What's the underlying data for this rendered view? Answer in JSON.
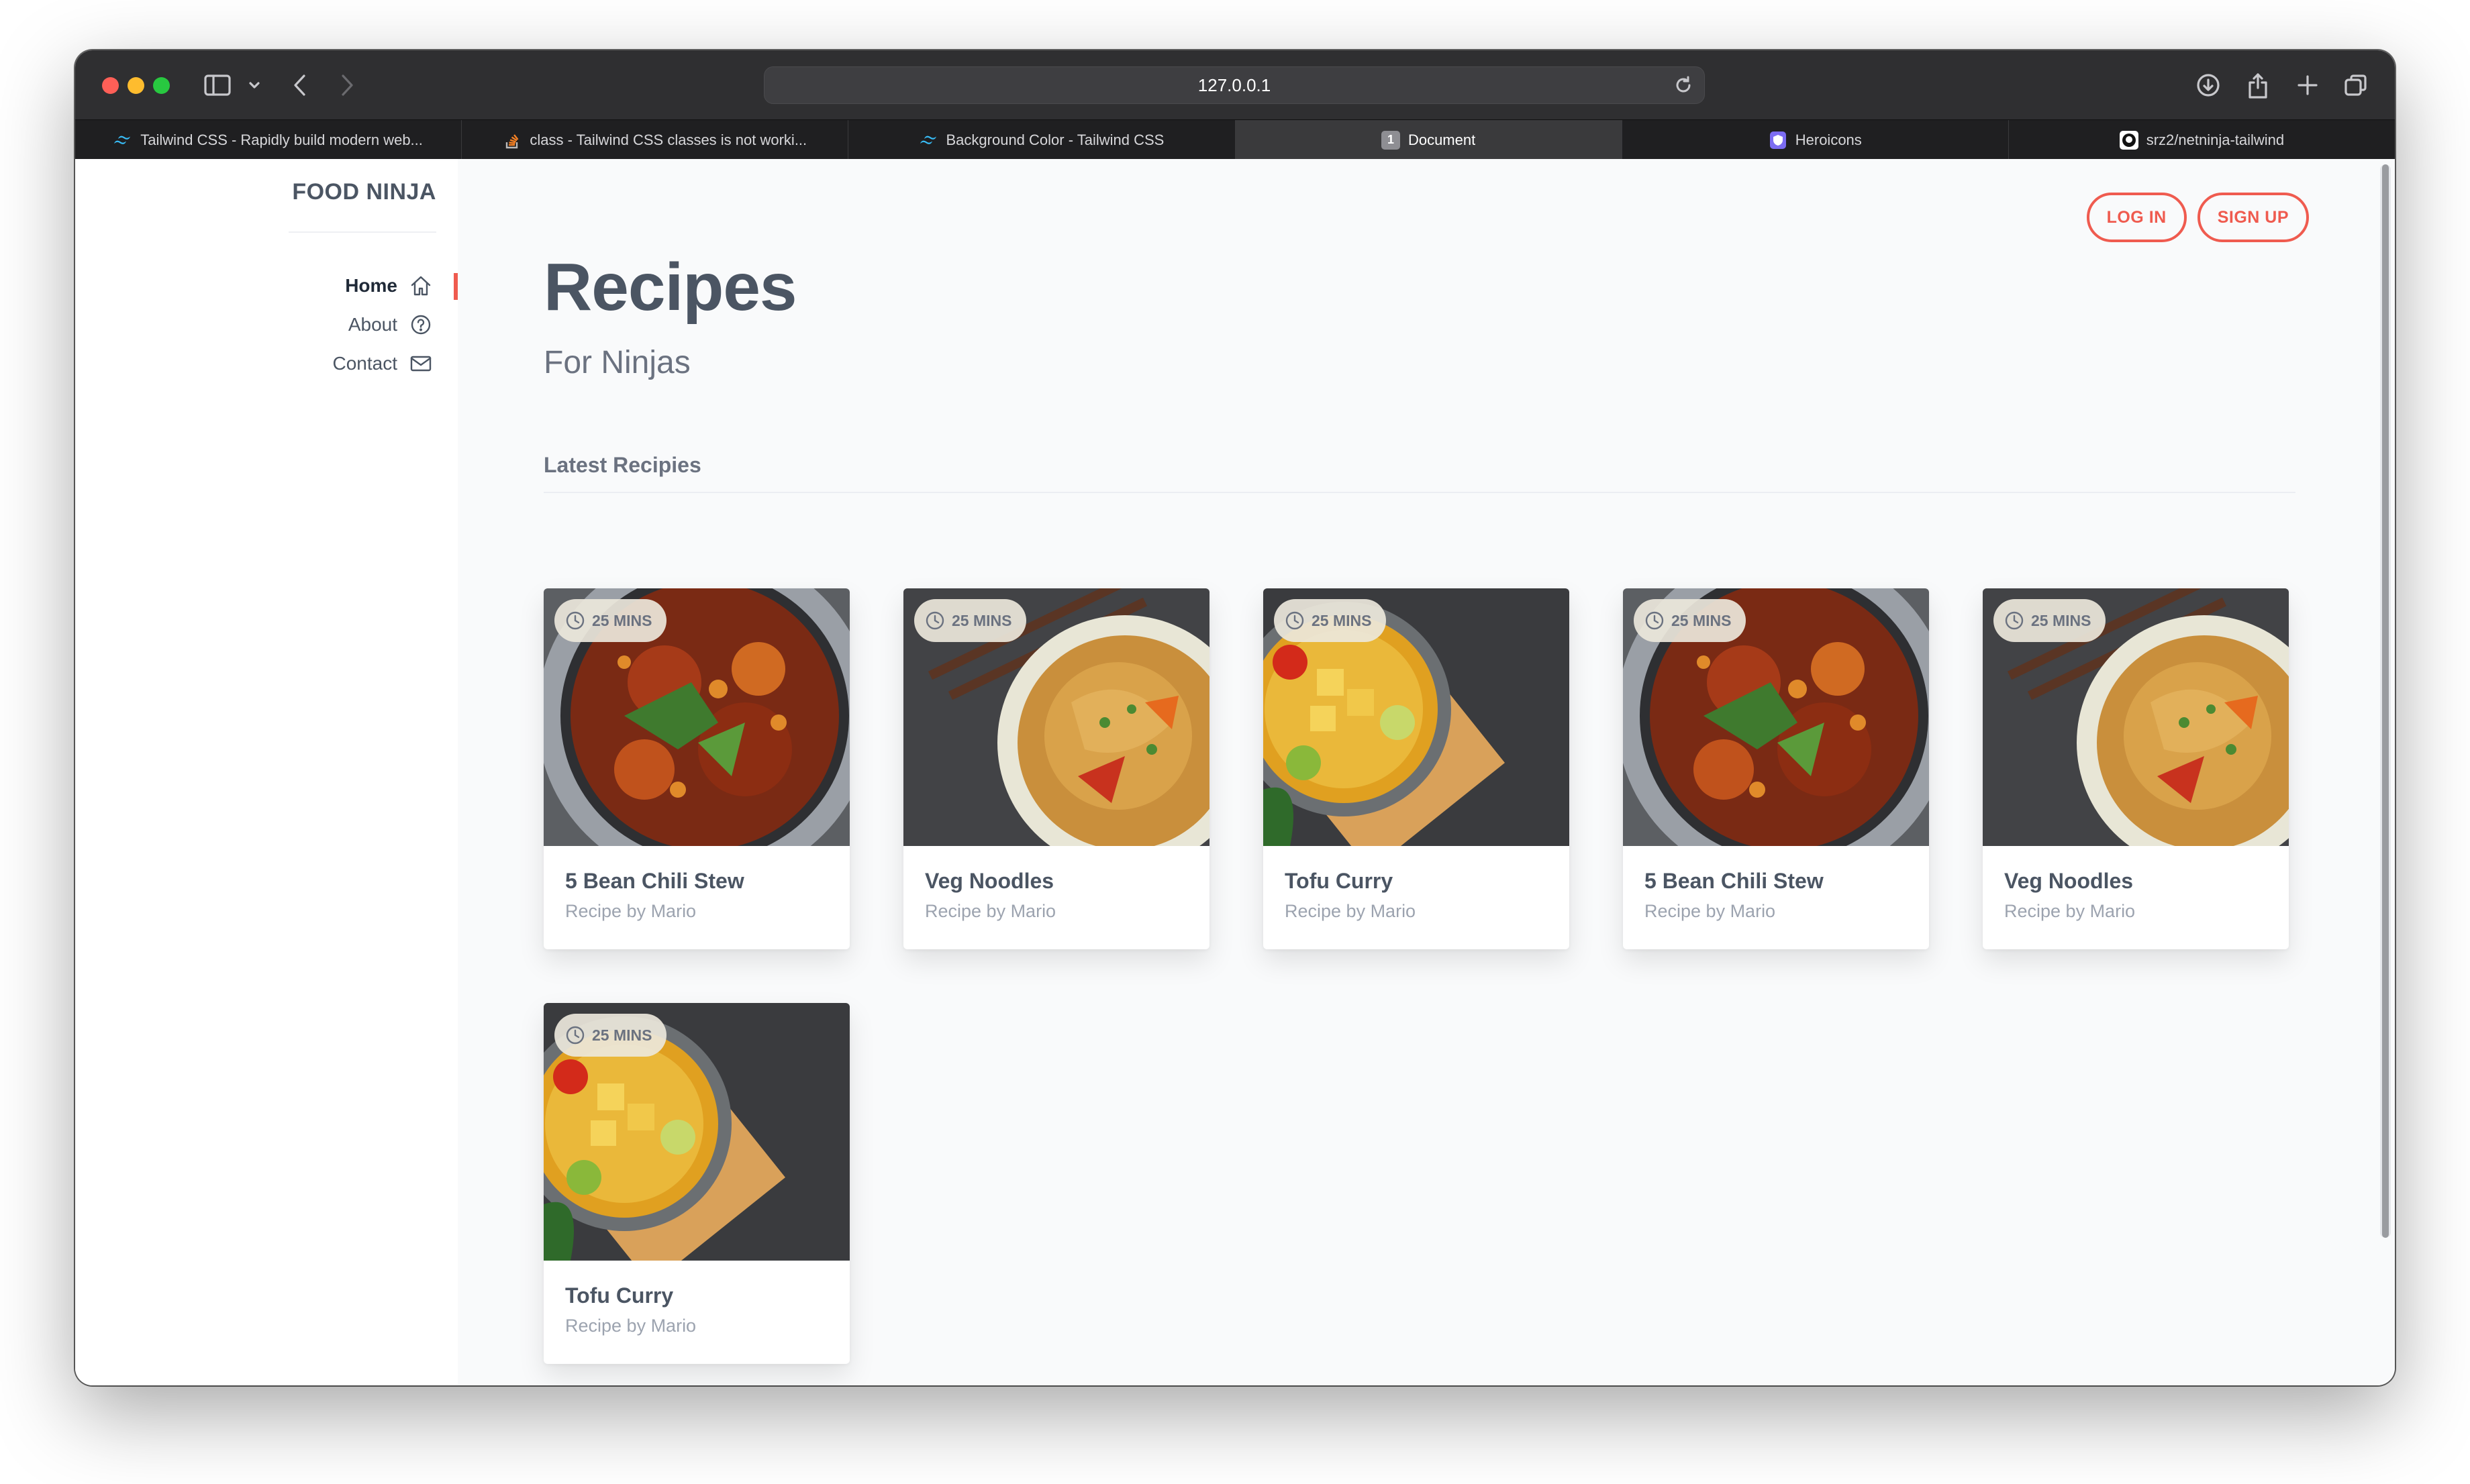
{
  "browser": {
    "url": "127.0.0.1",
    "tabs": [
      {
        "title": "Tailwind CSS - Rapidly build modern web...",
        "icon": "tailwind-icon",
        "active": false
      },
      {
        "title": "class - Tailwind CSS classes is not worki...",
        "icon": "stackoverflow-icon",
        "active": false
      },
      {
        "title": "Background Color - Tailwind CSS",
        "icon": "tailwind-icon",
        "active": false
      },
      {
        "title": "Document",
        "icon": "document-number-icon",
        "badge": "1",
        "active": true
      },
      {
        "title": "Heroicons",
        "icon": "heroicons-shield-icon",
        "active": false
      },
      {
        "title": "srz2/netninja-tailwind",
        "icon": "github-icon",
        "active": false
      }
    ]
  },
  "sidebar": {
    "brand": "FOOD NINJA",
    "nav": [
      {
        "label": "Home",
        "icon": "home-icon",
        "active": true
      },
      {
        "label": "About",
        "icon": "question-circle-icon",
        "active": false
      },
      {
        "label": "Contact",
        "icon": "mail-icon",
        "active": false
      }
    ]
  },
  "header": {
    "login": "LOG IN",
    "signup": "SIGN UP"
  },
  "main": {
    "title": "Recipes",
    "subtitle": "For Ninjas",
    "section": "Latest Recipies",
    "cards": [
      {
        "time": "25 MINS",
        "title": "5 Bean Chili Stew",
        "author": "Recipe by Mario",
        "image": "chili-stew"
      },
      {
        "time": "25 MINS",
        "title": "Veg Noodles",
        "author": "Recipe by Mario",
        "image": "veg-noodles"
      },
      {
        "time": "25 MINS",
        "title": "Tofu Curry",
        "author": "Recipe by Mario",
        "image": "tofu-curry"
      },
      {
        "time": "25 MINS",
        "title": "5 Bean Chili Stew",
        "author": "Recipe by Mario",
        "image": "chili-stew"
      },
      {
        "time": "25 MINS",
        "title": "Veg Noodles",
        "author": "Recipe by Mario",
        "image": "veg-noodles"
      },
      {
        "time": "25 MINS",
        "title": "Tofu Curry",
        "author": "Recipe by Mario",
        "image": "tofu-curry"
      }
    ]
  },
  "colors": {
    "accent": "#ef5b4f",
    "text": "#4b5563",
    "muted": "#9ca3af",
    "page_bg": "#f9fafb",
    "toolbar_bg": "#2f2f31"
  }
}
